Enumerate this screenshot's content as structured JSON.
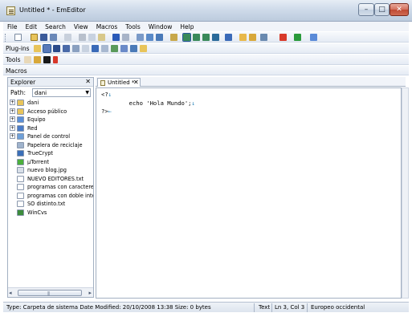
{
  "window": {
    "title": "Untitled * - EmEditor",
    "controls": {
      "minimize": "–",
      "maximize": "□",
      "close": "✕"
    }
  },
  "menu": [
    "File",
    "Edit",
    "Search",
    "View",
    "Macros",
    "Tools",
    "Window",
    "Help"
  ],
  "toolbars": {
    "plugins_label": "Plug-ins",
    "tools_label": "Tools",
    "macros_label": "Macros"
  },
  "explorer": {
    "title": "Explorer",
    "close": "✕",
    "path_label": "Path:",
    "path_value": "dani",
    "items": [
      {
        "label": "dani",
        "expandable": true,
        "icon_color": "#e8c45a"
      },
      {
        "label": "Acceso público",
        "expandable": true,
        "icon_color": "#e8c45a"
      },
      {
        "label": "Equipo",
        "expandable": true,
        "icon_color": "#5a8fd8"
      },
      {
        "label": "Red",
        "expandable": true,
        "icon_color": "#4a7cc8"
      },
      {
        "label": "Panel de control",
        "expandable": true,
        "icon_color": "#6fa0d8"
      },
      {
        "label": "Papelera de reciclaje",
        "expandable": false,
        "icon_color": "#9fb3cc"
      },
      {
        "label": "TrueCrypt",
        "expandable": false,
        "icon_color": "#3a6fb8"
      },
      {
        "label": "µTorrent",
        "expandable": false,
        "icon_color": "#4caf3c"
      },
      {
        "label": "nuevo blog.jpg",
        "expandable": false,
        "icon_color": "#d8dfe8"
      },
      {
        "label": "NUEVO EDITORES.txt",
        "expandable": false,
        "icon_color": "#ffffff"
      },
      {
        "label": "programas con caracteres ra",
        "expandable": false,
        "icon_color": "#ffffff"
      },
      {
        "label": "programas con doble interro",
        "expandable": false,
        "icon_color": "#ffffff"
      },
      {
        "label": "SO distinto.txt",
        "expandable": false,
        "icon_color": "#ffffff"
      },
      {
        "label": "WinCvs",
        "expandable": false,
        "icon_color": "#3c8c3c"
      }
    ],
    "scroll_grip": "|||",
    "scroll_left": "◂",
    "scroll_right": "▸"
  },
  "editor": {
    "tab_label": "Untitled *",
    "tab_close": "✕",
    "lines": [
      {
        "text": "<?",
        "eol": "↓"
      },
      {
        "text": "        echo 'Hola Mundo';",
        "eol": "↓"
      },
      {
        "text": "?>",
        "eol": "←"
      }
    ]
  },
  "status": {
    "info": "Type: Carpeta de sistema Date Modified: 20/10/2008 13:38 Size: 0 bytes",
    "mode": "Text",
    "position": "Ln 3, Col 3",
    "encoding": "Europeo occidental"
  },
  "colors": {
    "accent": "#3a6fb8",
    "eol_marker": "#1e7fb8"
  }
}
